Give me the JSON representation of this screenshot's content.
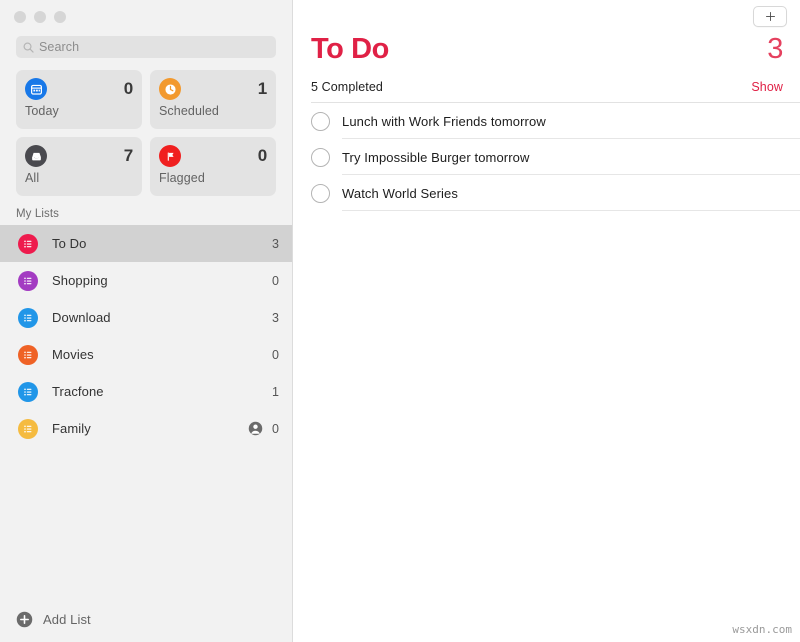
{
  "window": {
    "traffic_lights": [
      "close",
      "minimize",
      "zoom"
    ]
  },
  "sidebar": {
    "search": {
      "placeholder": "Search",
      "value": "",
      "icon": "search-icon"
    },
    "smart_lists": [
      {
        "label": "Today",
        "count": "0",
        "icon": "calendar-icon",
        "color": "#1878e8"
      },
      {
        "label": "Scheduled",
        "count": "1",
        "icon": "clock-icon",
        "color": "#f2992e"
      },
      {
        "label": "All",
        "count": "7",
        "icon": "inbox-icon",
        "color": "#4a4a4f"
      },
      {
        "label": "Flagged",
        "count": "0",
        "icon": "flag-icon",
        "color": "#f02020"
      }
    ],
    "section_title": "My Lists",
    "lists": [
      {
        "label": "To Do",
        "count": "3",
        "color": "#ee1b4d",
        "selected": true,
        "shared": false
      },
      {
        "label": "Shopping",
        "count": "0",
        "color": "#a33bc2",
        "selected": false,
        "shared": false
      },
      {
        "label": "Download",
        "count": "3",
        "color": "#2196e8",
        "selected": false,
        "shared": false
      },
      {
        "label": "Movies",
        "count": "0",
        "color": "#ef6226",
        "selected": false,
        "shared": false
      },
      {
        "label": "Tracfone",
        "count": "1",
        "color": "#2196e8",
        "selected": false,
        "shared": false
      },
      {
        "label": "Family",
        "count": "0",
        "color": "#f5bb40",
        "selected": false,
        "shared": true
      }
    ],
    "add_list": {
      "label": "Add List",
      "icon": "plus-circle-icon"
    }
  },
  "content": {
    "add_button": {
      "icon": "plus-icon",
      "label": "+"
    },
    "title": "To Do",
    "count": "3",
    "completed_text": "5 Completed",
    "show_label": "Show",
    "reminders": [
      {
        "text": "Lunch with Work Friends tomorrow",
        "done": false
      },
      {
        "text": "Try Impossible Burger tomorrow",
        "done": false
      },
      {
        "text": "Watch World Series",
        "done": false
      }
    ]
  },
  "watermark": "wsxdn.com",
  "colors": {
    "accent": "#e02146",
    "sidebar_bg": "#f2f2f2",
    "selection": "#d2d2d2"
  }
}
